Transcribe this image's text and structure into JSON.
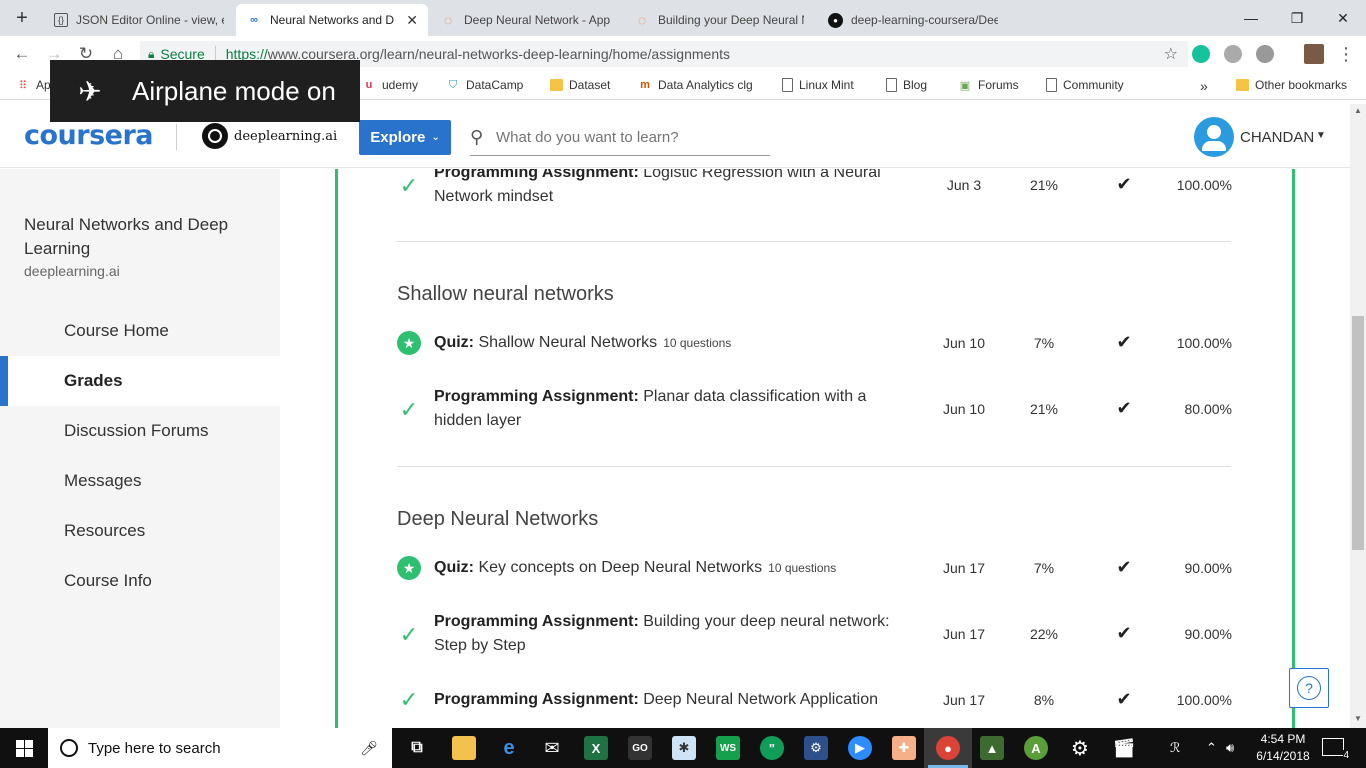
{
  "browser": {
    "tabs": [
      {
        "title": "JSON Editor Online - view, ed",
        "active": false
      },
      {
        "title": "Neural Networks and Dee",
        "active": true
      },
      {
        "title": "Deep Neural Network - Appl",
        "active": false
      },
      {
        "title": "Building your Deep Neural N",
        "active": false
      },
      {
        "title": "deep-learning-coursera/Deep",
        "active": false
      }
    ],
    "new_tab": "+",
    "close_tab": "✕",
    "minimize": "—",
    "restore": "❐",
    "close_window": "✕",
    "secure_label": "Secure",
    "url_scheme": "https://",
    "url_rest": "www.coursera.org/learn/neural-networks-deep-learning/home/assignments",
    "bookmarks": [
      "udemy",
      "DataCamp",
      "Dataset",
      "Data Analytics clg",
      "Linux Mint",
      "Blog",
      "Forums",
      "Community"
    ],
    "bookmarks_apps_partial": "Ap",
    "other_bookmarks": "Other bookmarks",
    "more_bookmarks": "»"
  },
  "toast": {
    "message": "Airplane mode on"
  },
  "header": {
    "logo": "coursera",
    "partner": "deeplearning.ai",
    "explore_label": "Explore",
    "search_placeholder": "What do you want to learn?",
    "username": "CHANDAN"
  },
  "sidebar": {
    "course_title": "Neural Networks and Deep Learning",
    "course_org": "deeplearning.ai",
    "items": [
      {
        "label": "Course Home",
        "active": false
      },
      {
        "label": "Grades",
        "active": true
      },
      {
        "label": "Discussion Forums",
        "active": false
      },
      {
        "label": "Messages",
        "active": false
      },
      {
        "label": "Resources",
        "active": false
      },
      {
        "label": "Course Info",
        "active": false
      }
    ]
  },
  "grades": {
    "sections": [
      {
        "title": "Shallow neural networks"
      },
      {
        "title": "Deep Neural Networks"
      }
    ],
    "rows": [
      {
        "type": "Programming Assignment:",
        "name": " Logistic Regression with a Neural Network mindset",
        "questions": "",
        "due": "Jun 3",
        "weight": "21%",
        "passed": "✔",
        "grade": "100.00%",
        "icon": "check-icon"
      },
      {
        "type": "Quiz:",
        "name": " Shallow Neural Networks",
        "questions": "10 questions",
        "due": "Jun 10",
        "weight": "7%",
        "passed": "✔",
        "grade": "100.00%",
        "icon": "star-badge-icon"
      },
      {
        "type": "Programming Assignment:",
        "name": " Planar data classification with a hidden layer",
        "questions": "",
        "due": "Jun 10",
        "weight": "21%",
        "passed": "✔",
        "grade": "80.00%",
        "icon": "check-icon"
      },
      {
        "type": "Quiz:",
        "name": " Key concepts on Deep Neural Networks",
        "questions": "10 questions",
        "due": "Jun 17",
        "weight": "7%",
        "passed": "✔",
        "grade": "90.00%",
        "icon": "star-badge-icon"
      },
      {
        "type": "Programming Assignment:",
        "name": " Building your deep neural network: Step by Step",
        "questions": "",
        "due": "Jun 17",
        "weight": "22%",
        "passed": "✔",
        "grade": "90.00%",
        "icon": "check-icon"
      },
      {
        "type": "Programming Assignment:",
        "name": " Deep Neural Network Application",
        "questions": "",
        "due": "Jun 17",
        "weight": "8%",
        "passed": "✔",
        "grade": "100.00%",
        "icon": "check-icon"
      }
    ]
  },
  "help_label": "?",
  "taskbar": {
    "search_placeholder": "Type here to search",
    "time": "4:54 PM",
    "date": "6/14/2018",
    "notification_count": "4"
  },
  "colors": {
    "accent": "#2a73cc",
    "success": "#2fbf71"
  }
}
